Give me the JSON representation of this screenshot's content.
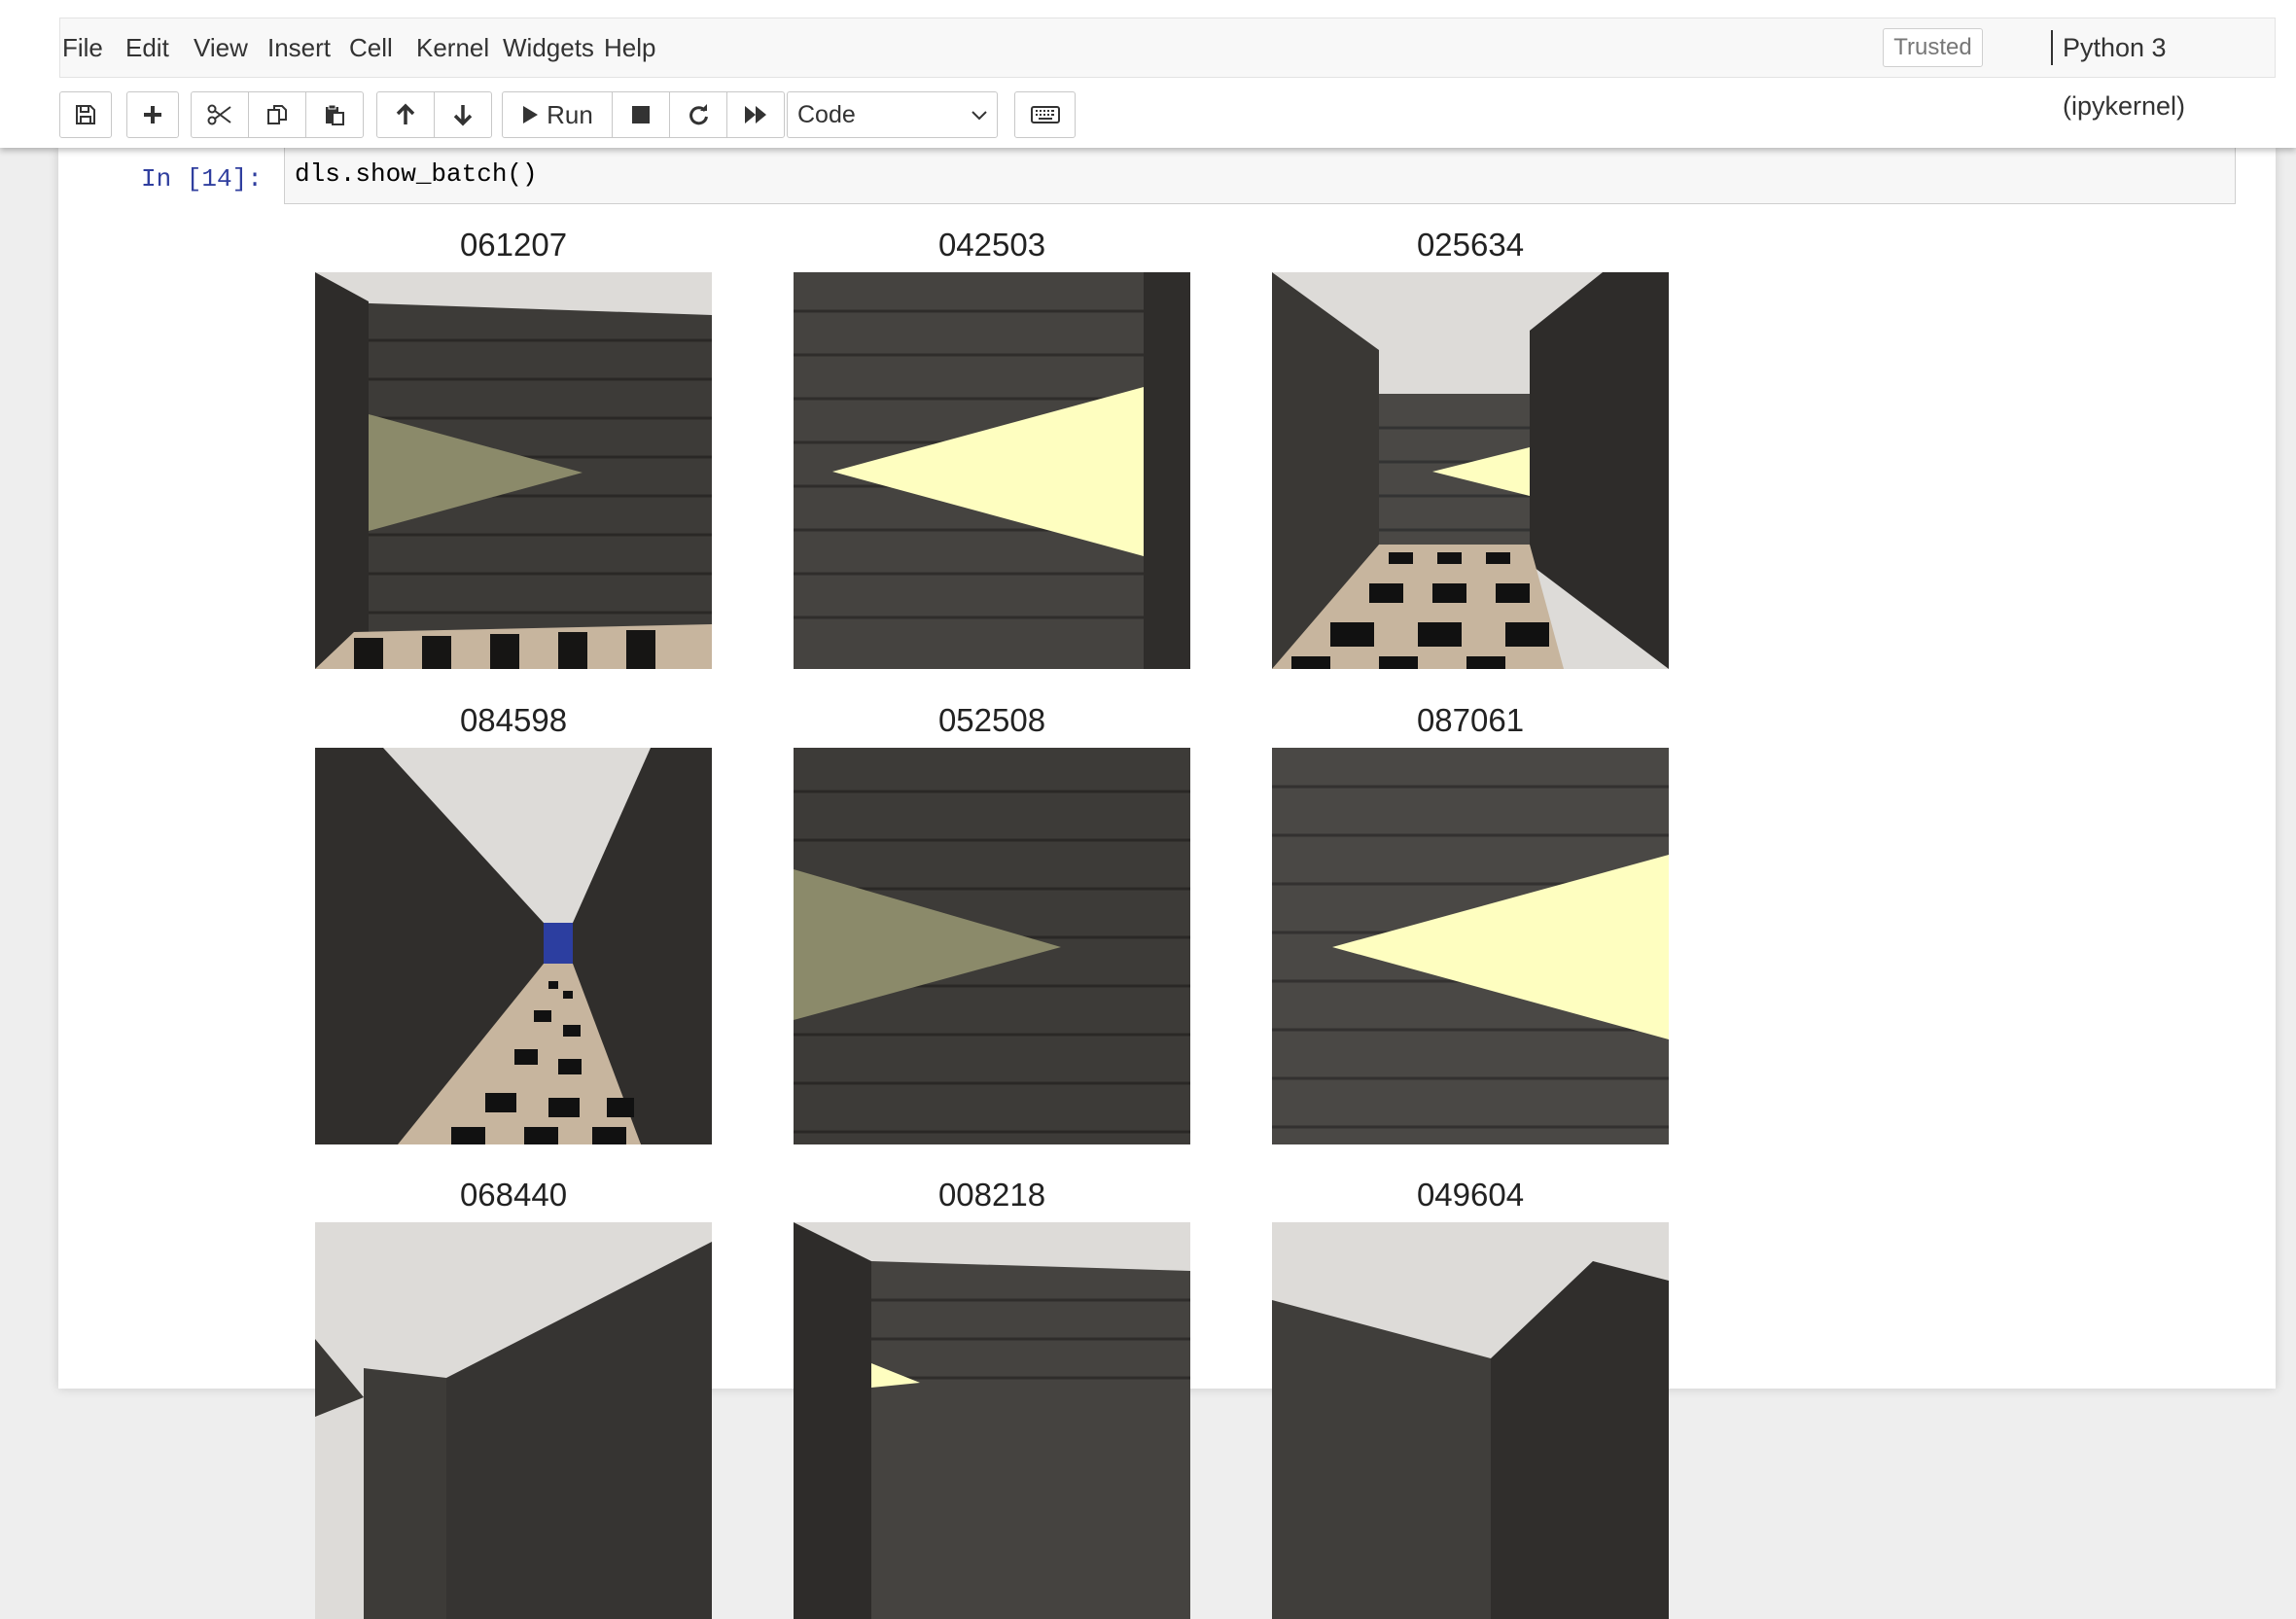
{
  "menubar": {
    "items": [
      "File",
      "Edit",
      "View",
      "Insert",
      "Cell",
      "Kernel",
      "Widgets",
      "Help"
    ],
    "trusted_label": "Trusted",
    "kernel_name": "Python 3 (ipykernel)"
  },
  "toolbar": {
    "buttons": [
      "save-icon",
      "plus-icon",
      "scissors-icon",
      "copy-icon",
      "paste-icon",
      "arrow-up-icon",
      "arrow-down-icon",
      "play-icon",
      "stop-icon",
      "restart-icon",
      "fast-forward-icon",
      "keyboard-icon"
    ],
    "run_label": "Run",
    "cell_type": "Code"
  },
  "cell": {
    "prompt": "In [14]:",
    "code": "dls.show_batch()"
  },
  "output": {
    "tiles": [
      {
        "label": "061207",
        "scene": "wall-left-olive"
      },
      {
        "label": "042503",
        "scene": "wall-yellow"
      },
      {
        "label": "025634",
        "scene": "corridor-right-yellow"
      },
      {
        "label": "084598",
        "scene": "corridor-blue"
      },
      {
        "label": "052508",
        "scene": "wall-olive"
      },
      {
        "label": "087061",
        "scene": "wall-yellow-right"
      },
      {
        "label": "068440",
        "scene": "corner-left"
      },
      {
        "label": "008218",
        "scene": "wall-top"
      },
      {
        "label": "049604",
        "scene": "corner-right"
      }
    ]
  },
  "colors": {
    "wall": "#3c3a37",
    "sky": "#dedcd9",
    "olive": "#8b8a6a",
    "pale_yellow": "#fefec0",
    "floor_light": "#c7b59e",
    "floor_dark": "#111111",
    "blue": "#2c3ea0",
    "prompt": "#303f9f"
  }
}
